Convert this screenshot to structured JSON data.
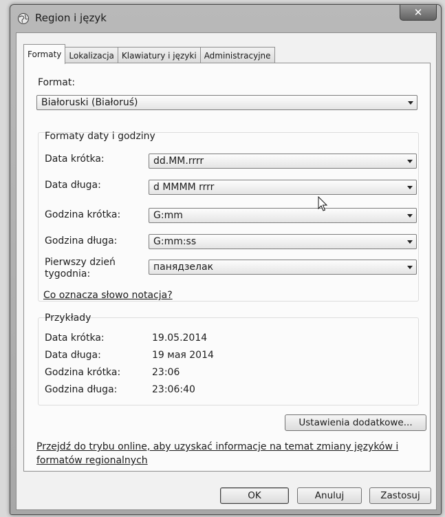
{
  "window": {
    "title": "Region i język"
  },
  "tabs": [
    {
      "label": "Formaty",
      "active": true
    },
    {
      "label": "Lokalizacja",
      "active": false
    },
    {
      "label": "Klawiatury i języki",
      "active": false
    },
    {
      "label": "Administracyjne",
      "active": false
    }
  ],
  "format": {
    "label": "Format:",
    "value": "Białoruski (Białoruś)"
  },
  "date_time": {
    "heading": "Formaty daty i godziny",
    "rows": [
      {
        "label": "Data krótka:",
        "value": "dd.MM.rrrr"
      },
      {
        "label": "Data długa:",
        "value": "d MMMM rrrr"
      },
      {
        "label": "Godzina krótka:",
        "value": "G:mm"
      },
      {
        "label": "Godzina długa:",
        "value": "G:mm:ss"
      },
      {
        "label": "Pierwszy dzień tygodnia:",
        "value": "панядзелак"
      }
    ],
    "notation_link": "Co oznacza słowo notacja?"
  },
  "examples": {
    "heading": "Przykłady",
    "rows": [
      {
        "label": "Data krótka:",
        "value": "19.05.2014"
      },
      {
        "label": "Data długa:",
        "value": "19 мая 2014"
      },
      {
        "label": "Godzina krótka:",
        "value": "23:06"
      },
      {
        "label": "Godzina długa:",
        "value": "23:06:40"
      }
    ]
  },
  "additional_settings_button": "Ustawienia dodatkowe...",
  "online_link": {
    "line1": "Przejdź do trybu online, aby uzyskać informacje na temat zmiany języków i",
    "line2": "formatów regionalnych"
  },
  "buttons": {
    "ok": "OK",
    "cancel": "Anuluj",
    "apply": "Zastosuj"
  }
}
